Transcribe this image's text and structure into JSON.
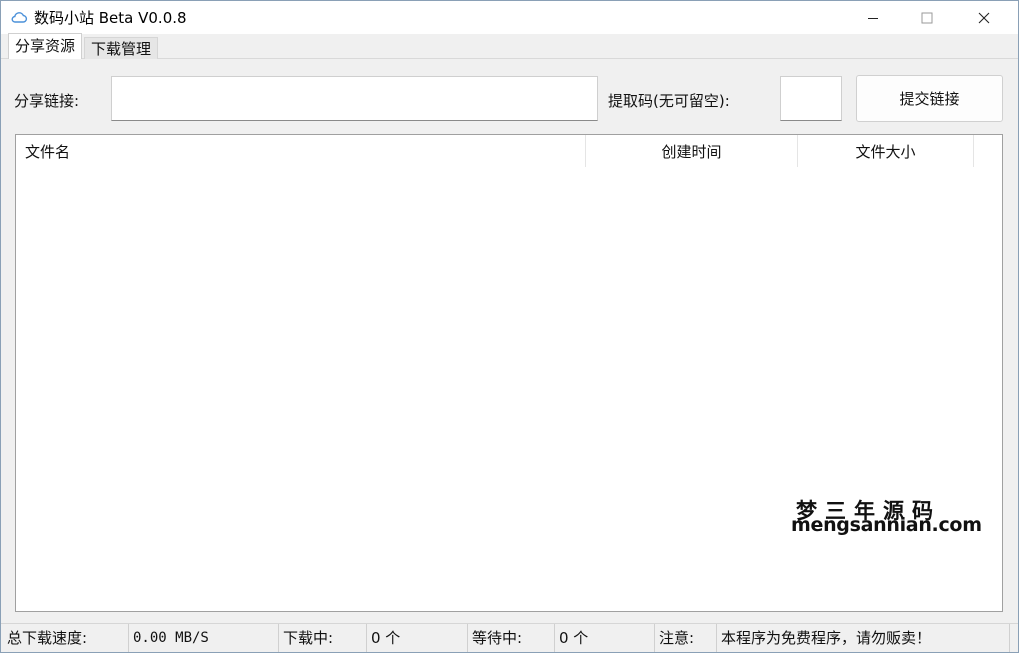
{
  "window": {
    "title": "数码小站 Beta V0.0.8",
    "minimize_glyph": "—",
    "maximize_glyph": "☐",
    "close_glyph": "✕"
  },
  "tabs": [
    {
      "label": "分享资源",
      "active": true
    },
    {
      "label": "下载管理",
      "active": false
    }
  ],
  "form": {
    "share_label": "分享链接:",
    "share_value": "",
    "code_label": "提取码(无可留空):",
    "code_value": "",
    "submit_label": "提交链接"
  },
  "list": {
    "columns": [
      "文件名",
      "创建时间",
      "文件大小"
    ],
    "rows": []
  },
  "watermark": {
    "cn": "梦三年源码",
    "en": "mengsannian.com"
  },
  "status": {
    "speed_label": "总下载速度:",
    "speed_value": "0.00 MB/S",
    "downloading_label": "下载中:",
    "downloading_value": "0 个",
    "waiting_label": "等待中:",
    "waiting_value": "0 个",
    "note_label": "注意:",
    "note_value": "本程序为免费程序，请勿贩卖！"
  },
  "colors": {
    "icon_accent": "#4a90d9",
    "window_bg": "#f0f0f0",
    "title_bg": "#ffffff"
  }
}
